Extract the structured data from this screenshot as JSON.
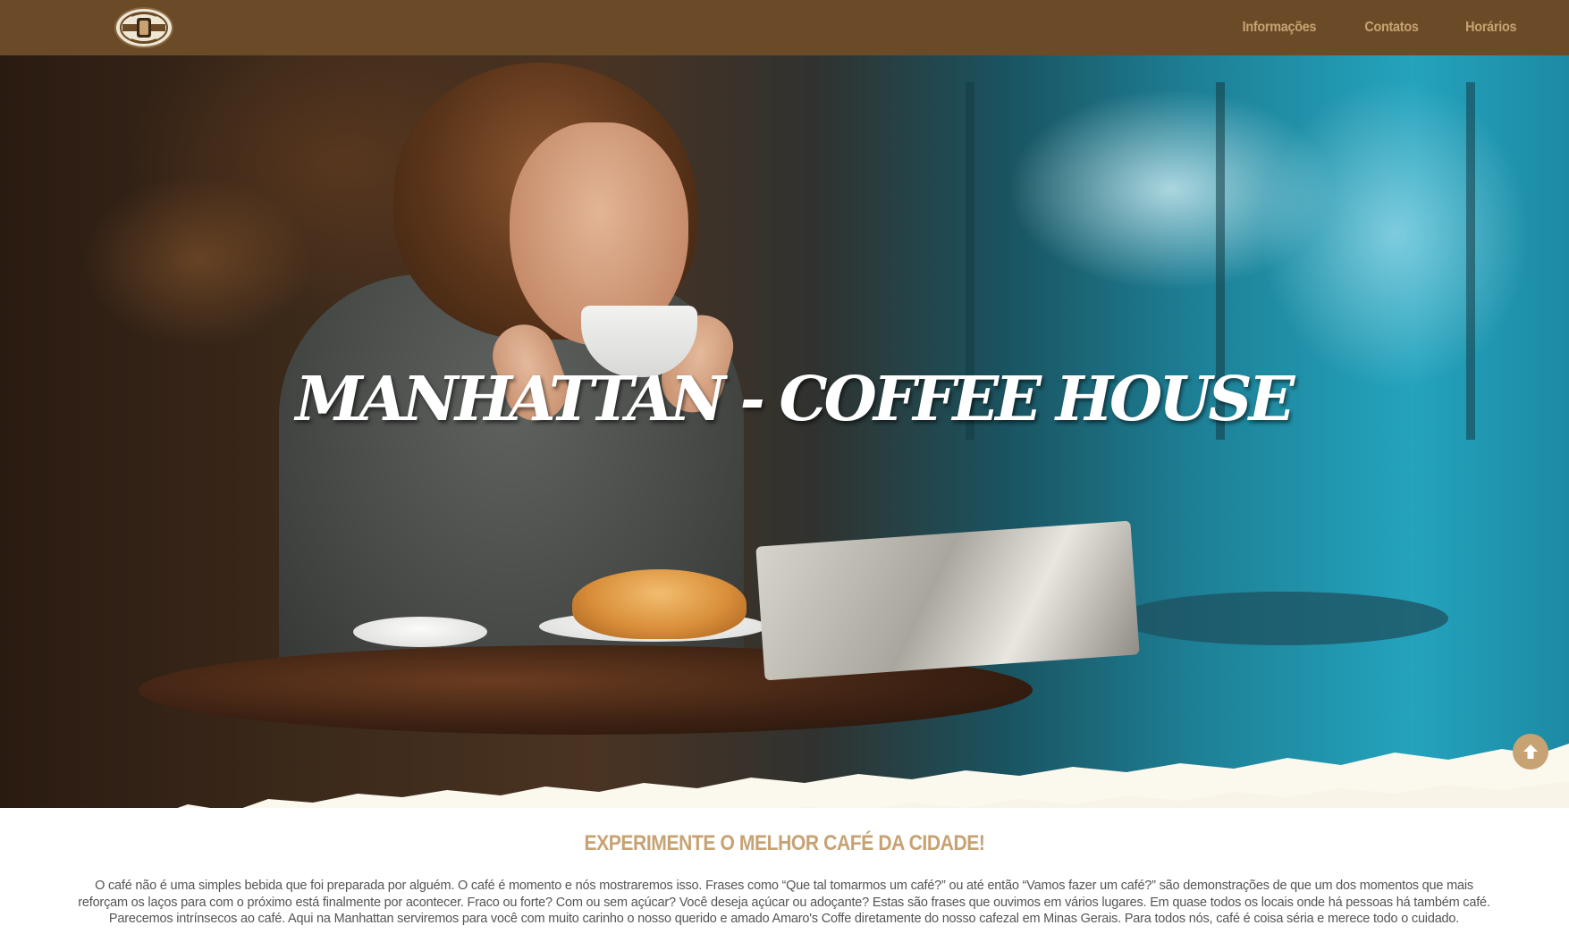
{
  "nav": {
    "logo_alt": "Manhattan Coffee House logo",
    "items": [
      {
        "label": "Informações"
      },
      {
        "label": "Contatos"
      },
      {
        "label": "Horários"
      }
    ]
  },
  "hero": {
    "title": "MANHATTAN - COFFEE HOUSE",
    "scroll_top_icon": "arrow-up-icon"
  },
  "intro": {
    "heading": "EXPERIMENTE O MELHOR CAFÉ DA CIDADE!",
    "text": "O café não é uma simples bebida que foi preparada por alguém. O café é momento e nós mostraremos isso. Frases como “Que tal tomarmos um café?” ou até então “Vamos fazer um café?” são demonstrações de que um dos momentos que mais reforçam os laços para com o próximo está finalmente por acontecer. Fraco ou forte? Com ou sem açúcar? Você deseja açúcar ou adoçante? Estas são frases que ouvimos em vários lugares. Em quase todos os locais onde há pessoas há também café. Parecemos intrínsecos ao café. Aqui na Manhattan serviremos para você com muito carinho o nosso querido e amado Amaro's Coffe diretamente do nosso cafezal em Minas Gerais. Para todos nós, café é coisa séria e merece todo o cuidado."
  },
  "colors": {
    "topbar": "#6b4b27",
    "accent": "#c7a273",
    "body_text": "#555555",
    "torn_paper": "#fbf8ee"
  }
}
